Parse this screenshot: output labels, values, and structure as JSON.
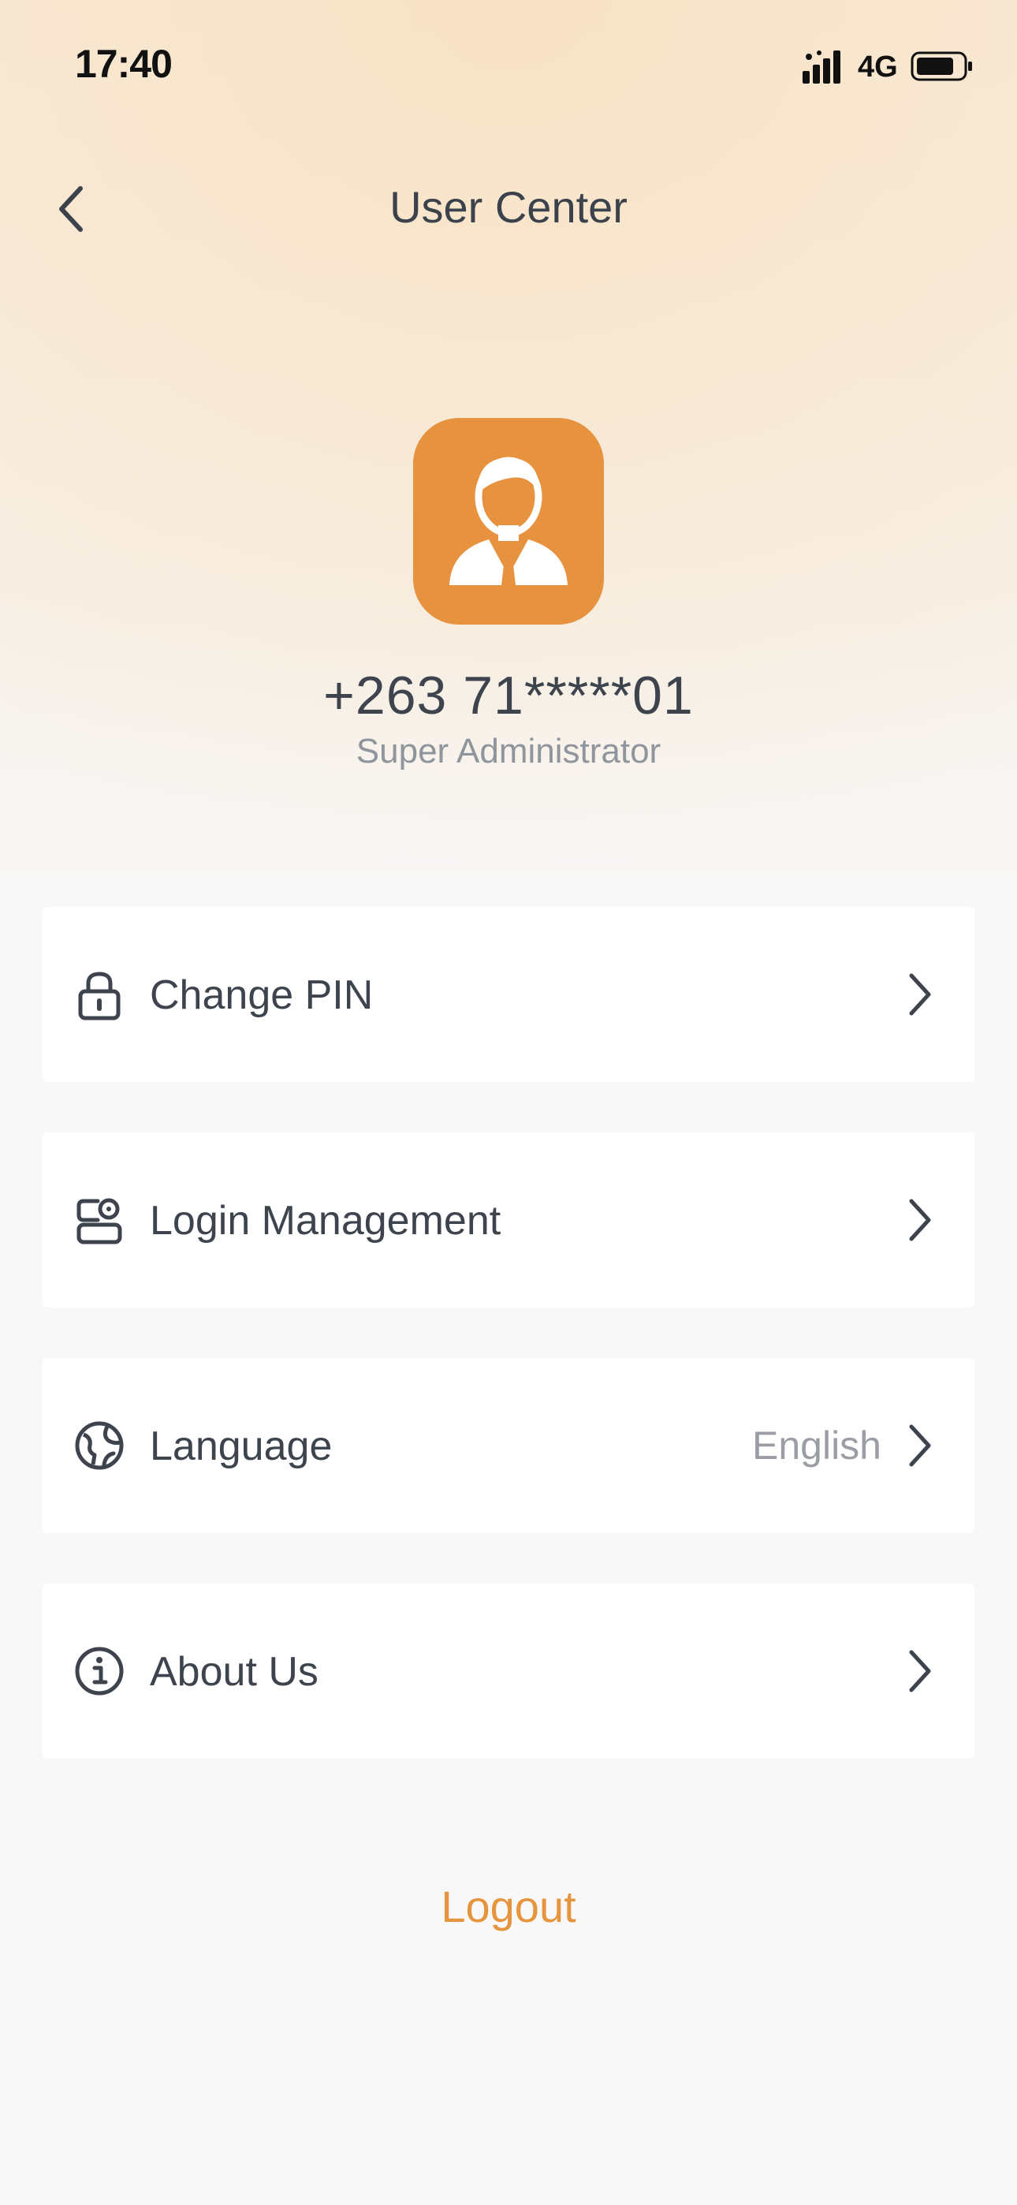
{
  "status_bar": {
    "time": "17:40",
    "network": "4G",
    "signal_icon": "signal-bars-icon",
    "battery_icon": "battery-icon"
  },
  "nav": {
    "title": "User Center",
    "back_icon": "chevron-left-icon"
  },
  "profile": {
    "phone": "+263 71*****01",
    "role": "Super Administrator",
    "avatar_icon": "businessman-avatar-icon",
    "avatar_color": "#e6923f"
  },
  "menu": {
    "items": [
      {
        "label": "Change PIN",
        "icon": "lock-icon",
        "value": ""
      },
      {
        "label": "Login Management",
        "icon": "device-management-icon",
        "value": ""
      },
      {
        "label": "Language",
        "icon": "globe-icon",
        "value": "English"
      },
      {
        "label": "About Us",
        "icon": "info-icon",
        "value": ""
      }
    ]
  },
  "logout": {
    "label": "Logout",
    "color": "#e6953f"
  }
}
